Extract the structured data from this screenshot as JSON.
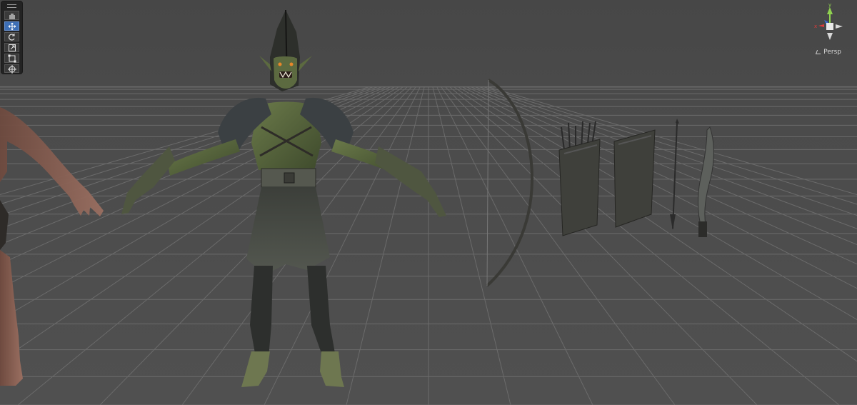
{
  "toolbar": {
    "tools": [
      {
        "name": "hand-tool",
        "icon": "hand-icon",
        "active": false
      },
      {
        "name": "move-tool",
        "icon": "move-arrows-icon",
        "active": true
      },
      {
        "name": "rotate-tool",
        "icon": "rotate-icon",
        "active": false
      },
      {
        "name": "scale-tool",
        "icon": "scale-icon",
        "active": false
      },
      {
        "name": "rect-tool",
        "icon": "rect-transform-icon",
        "active": false
      },
      {
        "name": "transform-tool",
        "icon": "transform-icon",
        "active": false
      }
    ]
  },
  "gizmo": {
    "projection_label": "Persp",
    "axis_colors": {
      "x": "#e03b3b",
      "y": "#8fd14f",
      "z": "#3a6fd8",
      "neutral": "#d8d8d8"
    }
  },
  "scene": {
    "background": "#4a4a4a",
    "grid_color": "#6a6a6a",
    "objects": [
      "human-character-model",
      "orc-character-model",
      "bow-prop",
      "quiver-with-arrows-prop",
      "empty-quiver-prop",
      "arrow-prop",
      "curved-sword-prop"
    ]
  }
}
